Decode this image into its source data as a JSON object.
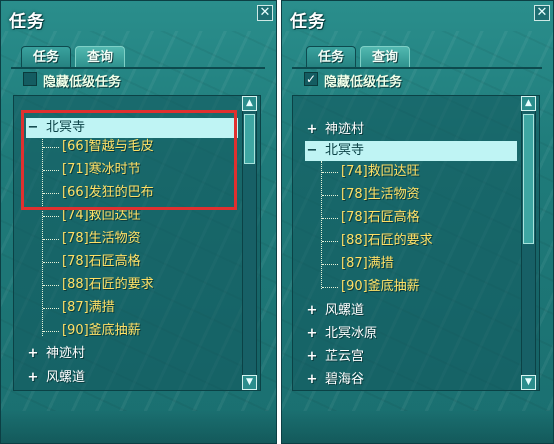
{
  "panels": [
    {
      "title": "任务",
      "close_glyph": "✕",
      "tabs": [
        {
          "label": "任务"
        },
        {
          "label": "查询"
        }
      ],
      "active_tab": "查询",
      "hide_low_level": {
        "label": "隐藏低级任务",
        "checked": false
      },
      "tree": [
        {
          "toggle": "−",
          "label": "北冥寺",
          "level": 0,
          "selected": true
        },
        {
          "label": "[66]智越与毛皮",
          "level": 1
        },
        {
          "label": "[71]寒冰时节",
          "level": 1
        },
        {
          "label": "[66]发狂的巴布",
          "level": 1
        },
        {
          "label": "[74]救回达旺",
          "level": 1
        },
        {
          "label": "[78]生活物资",
          "level": 1
        },
        {
          "label": "[78]石匠高格",
          "level": 1
        },
        {
          "label": "[88]石匠的要求",
          "level": 1
        },
        {
          "label": "[87]满措",
          "level": 1
        },
        {
          "label": "[90]釜底抽薪",
          "level": 1
        },
        {
          "toggle": "+",
          "label": "神迹村",
          "level": 0
        },
        {
          "toggle": "+",
          "label": "风螺道",
          "level": 0
        }
      ],
      "highlight_color": "#e0302f"
    },
    {
      "title": "任务",
      "close_glyph": "✕",
      "tabs": [
        {
          "label": "任务"
        },
        {
          "label": "查询"
        }
      ],
      "active_tab": "查询",
      "hide_low_level": {
        "label": "隐藏低级任务",
        "checked": true,
        "glyph": "✓"
      },
      "tree": [
        {
          "toggle": "+",
          "label": "神迹村",
          "level": 0
        },
        {
          "toggle": "−",
          "label": "北冥寺",
          "level": 0,
          "selected": true
        },
        {
          "label": "[74]救回达旺",
          "level": 1
        },
        {
          "label": "[78]生活物资",
          "level": 1
        },
        {
          "label": "[78]石匠高格",
          "level": 1
        },
        {
          "label": "[88]石匠的要求",
          "level": 1
        },
        {
          "label": "[87]满措",
          "level": 1
        },
        {
          "label": "[90]釜底抽薪",
          "level": 1
        },
        {
          "toggle": "+",
          "label": "风螺道",
          "level": 0
        },
        {
          "toggle": "+",
          "label": "北冥冰原",
          "level": 0
        },
        {
          "toggle": "+",
          "label": "芷云宫",
          "level": 0
        },
        {
          "toggle": "+",
          "label": "碧海谷",
          "level": 0
        }
      ]
    }
  ],
  "scroll": {
    "up_glyph": "▲",
    "down_glyph": "▼"
  },
  "colors": {
    "panel_bg": "#1f7b7a",
    "child_text": "#ffe066",
    "selected_bg": "#bff4f4",
    "highlight": "#e0302f"
  }
}
